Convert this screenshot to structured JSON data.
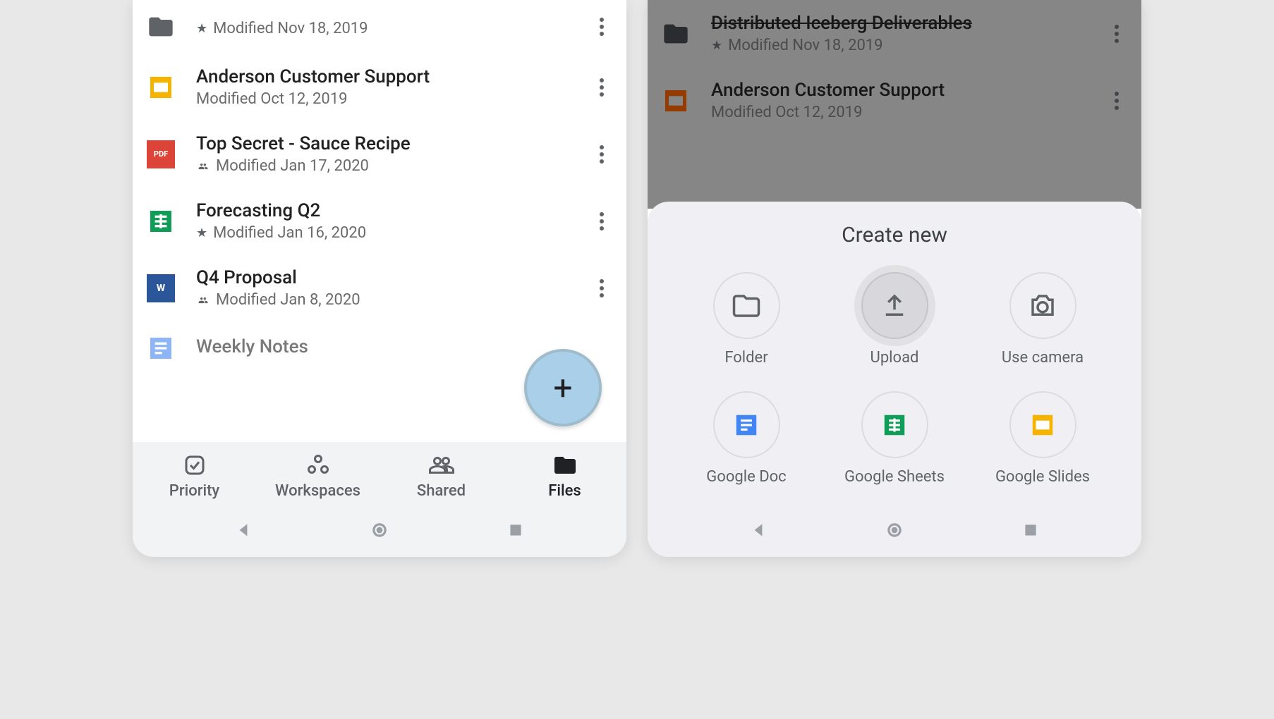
{
  "left": {
    "files": [
      {
        "title": "",
        "meta": "Modified Nov 18, 2019",
        "starred": true,
        "shared": false,
        "type": "folder"
      },
      {
        "title": "Anderson Customer Support",
        "meta": "Modified Oct 12, 2019",
        "starred": false,
        "shared": false,
        "type": "slides"
      },
      {
        "title": "Top Secret - Sauce Recipe",
        "meta": "Modified Jan 17, 2020",
        "starred": false,
        "shared": true,
        "type": "pdf"
      },
      {
        "title": "Forecasting Q2",
        "meta": "Modified Jan 16, 2020",
        "starred": true,
        "shared": false,
        "type": "sheets"
      },
      {
        "title": "Q4 Proposal",
        "meta": "Modified Jan 8, 2020",
        "starred": false,
        "shared": true,
        "type": "word"
      },
      {
        "title": "Weekly Notes",
        "meta": "",
        "starred": false,
        "shared": false,
        "type": "docs"
      }
    ],
    "nav": {
      "priority": "Priority",
      "workspaces": "Workspaces",
      "shared": "Shared",
      "files": "Files"
    }
  },
  "right": {
    "files": [
      {
        "title": "Distributed Iceberg Deliverables",
        "meta": "Modified Nov 18, 2019",
        "starred": true,
        "shared": false,
        "type": "folder"
      },
      {
        "title": "Anderson Customer Support",
        "meta": "Modified Oct 12, 2019",
        "starred": false,
        "shared": false,
        "type": "slides"
      }
    ],
    "sheet": {
      "title": "Create new",
      "items": {
        "folder": "Folder",
        "upload": "Upload",
        "camera": "Use camera",
        "doc": "Google Doc",
        "sheets": "Google Sheets",
        "slides": "Google Slides"
      }
    }
  }
}
